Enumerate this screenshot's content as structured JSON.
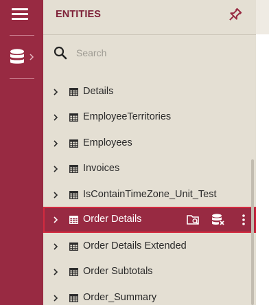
{
  "rail": {
    "menu_icon": "hamburger-menu-icon",
    "database_icon": "database-icon",
    "chevron_icon": "chevron-right-icon"
  },
  "panel": {
    "title": "ENTITIES",
    "pin_icon": "pin-icon",
    "search": {
      "placeholder": "Search",
      "value": "",
      "icon": "search-icon"
    }
  },
  "tree": {
    "items": [
      {
        "label": "Details",
        "selected": false
      },
      {
        "label": "EmployeeTerritories",
        "selected": false
      },
      {
        "label": "Employees",
        "selected": false
      },
      {
        "label": "Invoices",
        "selected": false
      },
      {
        "label": "IsContainTimeZone_Unit_Test",
        "selected": false
      },
      {
        "label": "Order Details",
        "selected": true
      },
      {
        "label": "Order Details Extended",
        "selected": false
      },
      {
        "label": "Order Subtotals",
        "selected": false
      },
      {
        "label": "Order_Summary",
        "selected": false
      }
    ],
    "selected_actions": [
      "folder-search-icon",
      "database-remove-icon",
      "more-vertical-icon"
    ]
  },
  "colors": {
    "accent": "#982a42",
    "panel_bg": "#e4dfd3",
    "title": "#7e2138",
    "selection_border": "#d22a3f"
  }
}
